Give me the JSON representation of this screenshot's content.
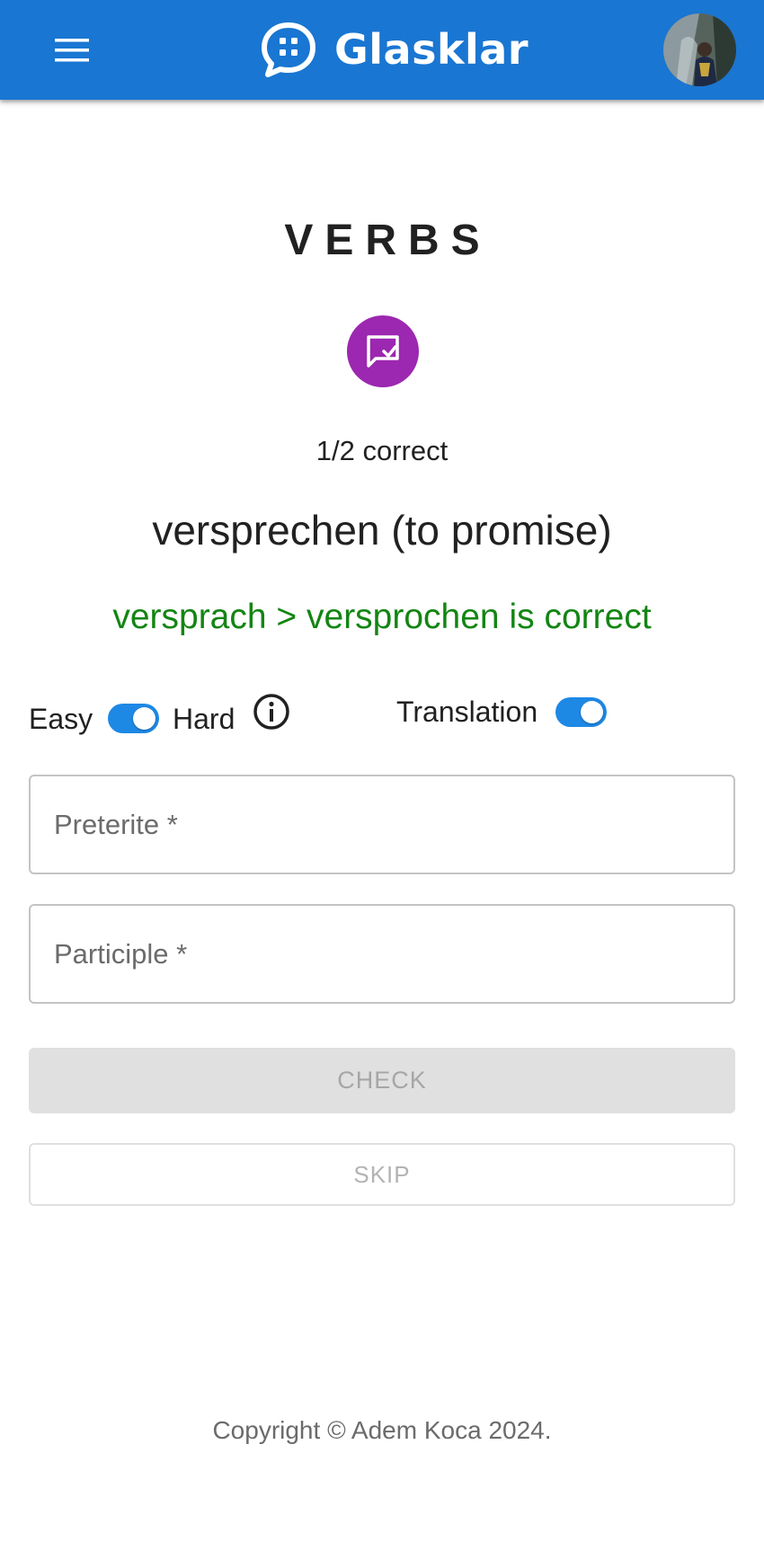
{
  "app": {
    "name": "Glasklar",
    "colors": {
      "primary": "#1976d2",
      "badge": "#9c27b0",
      "success": "#138513",
      "switch": "#1e88e5"
    },
    "menu_icon": "menu-icon",
    "logo_icon": "chat-dots-logo-icon",
    "avatar_icon": "user-avatar"
  },
  "exercise": {
    "title": "VERBS",
    "badge_icon": "message-check-icon",
    "score": "1/2 correct",
    "word": "versprechen (to promise)",
    "feedback": "versprach > versprochen is correct"
  },
  "settings": {
    "easy_label": "Easy",
    "hard_label": "Hard",
    "difficulty_hard": true,
    "info_icon": "info-icon",
    "translation_label": "Translation",
    "translation_on": true
  },
  "form": {
    "preterite_placeholder": "Preterite *",
    "preterite_value": "",
    "participle_placeholder": "Participle *",
    "participle_value": "",
    "check_label": "CHECK",
    "skip_label": "SKIP"
  },
  "footer": {
    "copyright": "Copyright © Adem Koca 2024."
  }
}
